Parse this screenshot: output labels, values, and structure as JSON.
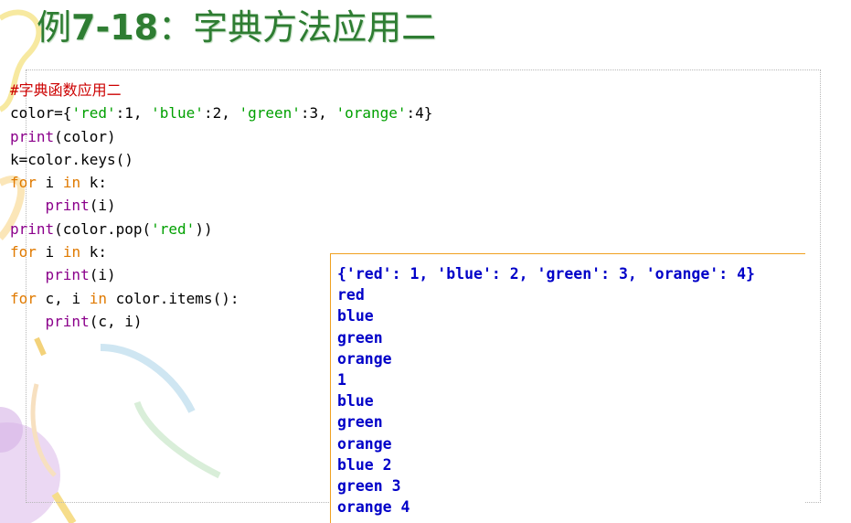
{
  "slide": {
    "title_prefix": "例",
    "title_number": "7-18",
    "title_suffix": "：字典方法应用二"
  },
  "code": {
    "comment": "#字典函数应用二",
    "lines": [
      "color={'red':1, 'blue':2, 'green':3, 'orange':4}",
      "print(color)",
      "k=color.keys()",
      "for i in k:",
      "    print(i)",
      "print(color.pop('red'))",
      "for i in k:",
      "    print(i)",
      "for c, i in color.items():",
      "    print(c, i)"
    ]
  },
  "output": {
    "lines": [
      "{'red': 1, 'blue': 2, 'green': 3, 'orange': 4}",
      "red",
      "blue",
      "green",
      "orange",
      "1",
      "blue",
      "green",
      "orange",
      "blue 2",
      "green 3",
      "orange 4"
    ]
  },
  "colors": {
    "title": "#2e7d32",
    "comment": "#cc0000",
    "keyword": "#e07a00",
    "string": "#00a000",
    "output_text": "#0000c8",
    "output_border": "#f0a020"
  }
}
